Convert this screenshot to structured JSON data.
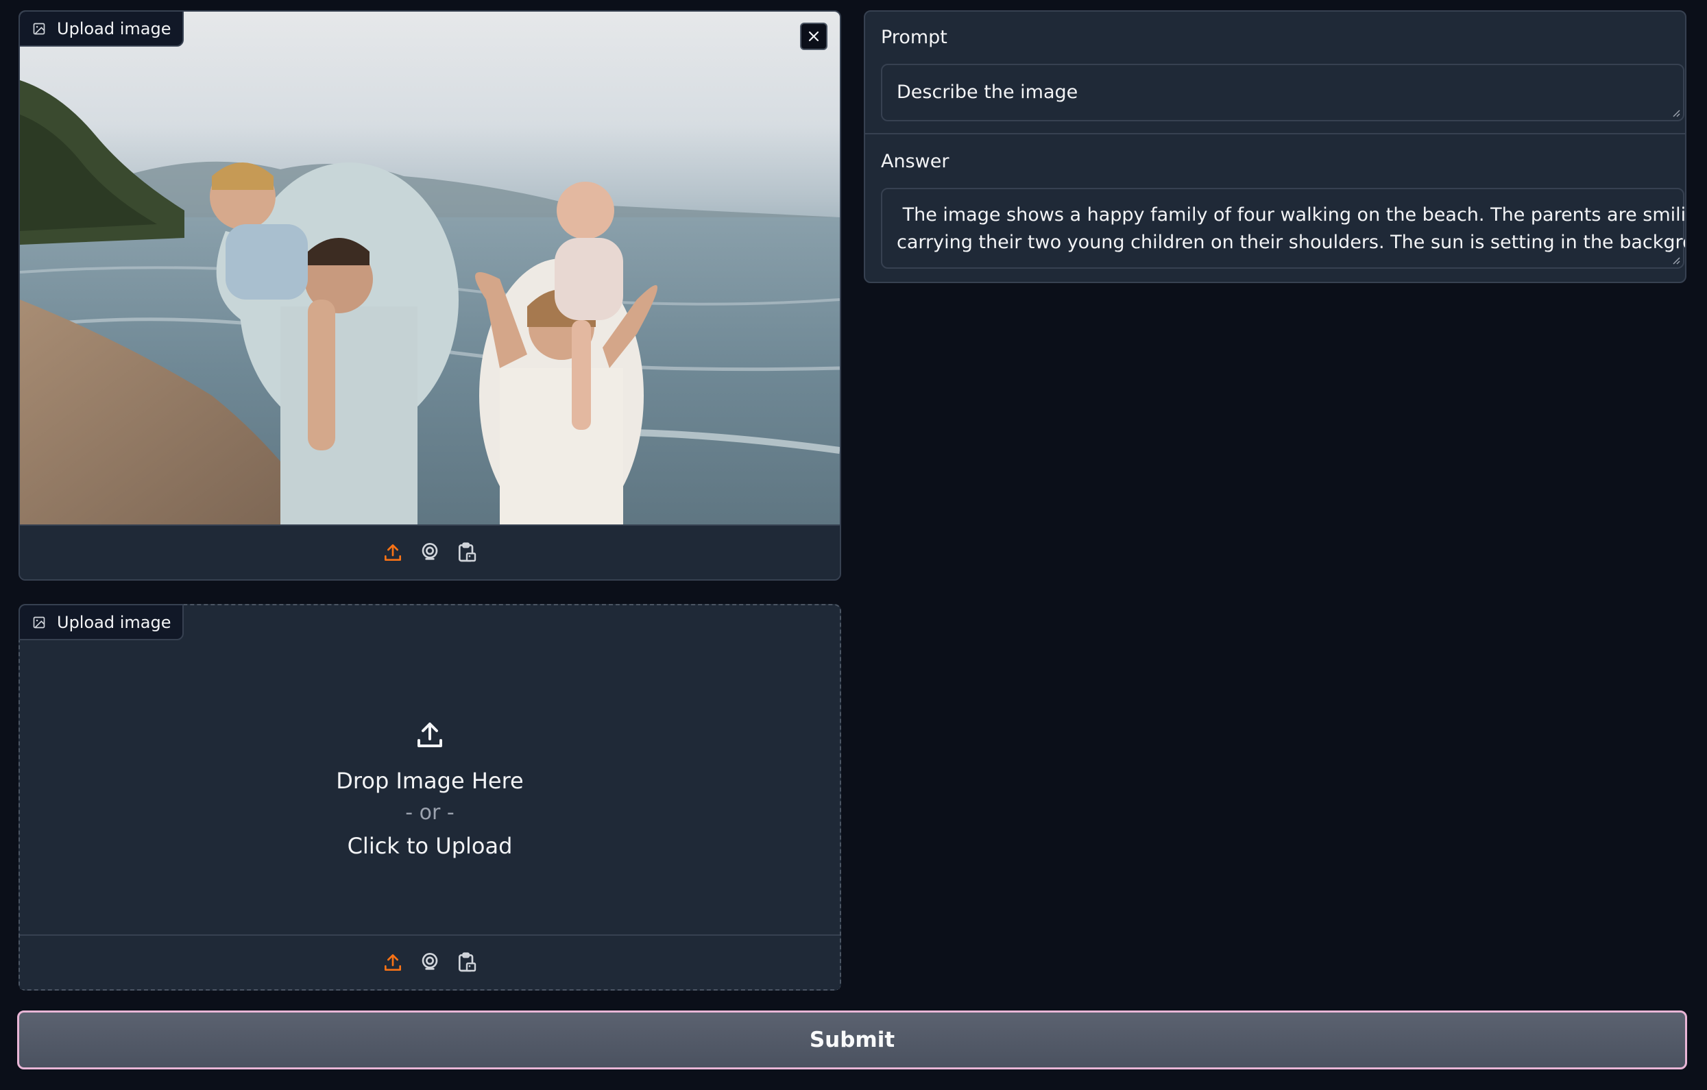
{
  "image_input_1": {
    "label": "Upload image",
    "has_image": true,
    "image_description_icon": "image-icon",
    "close_icon": "close-icon",
    "toolbar_icons": [
      "upload-icon",
      "webcam-icon",
      "clipboard-icon"
    ]
  },
  "image_input_2": {
    "label": "Upload image",
    "drop_title": "Drop Image Here",
    "drop_or": "- or -",
    "drop_click": "Click to Upload",
    "toolbar_icons": [
      "upload-icon",
      "webcam-icon",
      "clipboard-icon"
    ]
  },
  "prompt": {
    "label": "Prompt",
    "value": "Describe the image"
  },
  "answer": {
    "label": "Answer",
    "line1": " The image shows a happy family of four walking on the beach. The parents are smiling and",
    "line2": "carrying their two young children on their shoulders. The sun is setting in the background."
  },
  "submit": {
    "label": "Submit"
  },
  "colors": {
    "background": "#0b0f19",
    "panel": "#1f2937",
    "border": "#374151",
    "accent_orange": "#f97316",
    "submit_border": "#e9b6d6"
  }
}
